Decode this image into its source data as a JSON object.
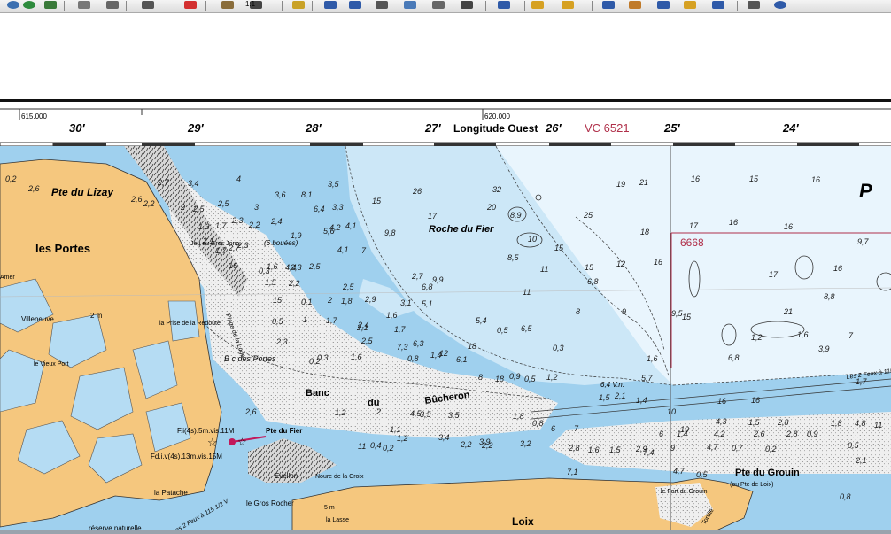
{
  "toolbar": {
    "icons": [
      "globe-icon",
      "refresh-icon",
      "save-icon",
      "page-icon",
      "print-icon",
      "list-icon",
      "close-icon",
      "zoom-icon",
      "zoom-1to1-icon",
      "pan-icon",
      "back-icon",
      "forward-icon",
      "window-icon",
      "layers-icon",
      "edit-icon",
      "dropdown-icon",
      "info-icon",
      "folder-open-icon",
      "folder-icon",
      "binoculars-icon",
      "printer-icon",
      "display-icon",
      "export-icon",
      "import-icon",
      "settings-icon",
      "help-icon"
    ],
    "zoom_label": "1:1"
  },
  "chart_border": {
    "grid_ref_left": "615.000",
    "grid_ref_mid": "620.000",
    "longitudes": [
      "30′",
      "29′",
      "28′",
      "27′",
      "26′",
      "25′",
      "24′"
    ],
    "axis_title": "Longitude Ouest",
    "sheet_ref": "VC 6521",
    "chart_ref": "6668",
    "corner_letter": "P"
  },
  "places": {
    "pte_lizay": "Pte du Lizay",
    "les_portes": "les Portes",
    "amer": "Amer",
    "villeneuve": "Villeneuve",
    "prise_redoute": "la Prise de la Redoute",
    "vieux_port": "le Vieux Port",
    "roche_fier": "Roche du Fier",
    "banc": "Banc",
    "du": "du",
    "bucheron": "Bûcheron",
    "bc_portes": "B c des Portes",
    "plage_loge": "Plage de la Loge",
    "jeu_gros_jonc": "Jeu du Gros Jonc",
    "six_bouees": "(6 bouées)",
    "light1": "F.i(4s).5m.vis.11M",
    "light2": "Fd.i.v(4s).13m.vis.15M",
    "pte_fier": "Pte du Fier",
    "la_patache": "la Patache",
    "evellon": "Evellon",
    "noure_croix": "Noure de la Croix",
    "gros_rocher": "le Gros Rocher",
    "la_lasse": "la Lasse",
    "loix": "Loix",
    "fort_grouin": "le Fort du Grouin",
    "pte_grouin": "Pte du Grouin",
    "pte_loix": "(ou Pte de Loix)",
    "reserve": "réserve naturelle",
    "balisee": "balisée",
    "deux_feux": "Les 2 Feux à 115",
    "deux_feux_2": "Les 2 Feux à 115 1/2 V",
    "la_peux": "le Peux",
    "tonne": "Tonillé",
    "deux_m": "2 m",
    "cinq_m": "5 m",
    "vn": "6,4 V.n."
  },
  "soundings": [
    {
      "t": "0,2"
    },
    {
      "t": "2,6"
    },
    {
      "t": "2,7"
    },
    {
      "t": "3,4"
    },
    {
      "t": "4"
    },
    {
      "t": "3,6"
    },
    {
      "t": "8,1"
    },
    {
      "t": "3,5"
    },
    {
      "t": "3,3"
    },
    {
      "t": "15"
    },
    {
      "t": "26"
    },
    {
      "t": "32"
    },
    {
      "t": "20"
    },
    {
      "t": "8,9"
    },
    {
      "t": "19"
    },
    {
      "t": "21"
    },
    {
      "t": "16"
    },
    {
      "t": "15"
    },
    {
      "t": "16"
    },
    {
      "t": "2,6"
    },
    {
      "t": "2,2"
    },
    {
      "t": "2"
    },
    {
      "t": "2,5"
    },
    {
      "t": "2,5"
    },
    {
      "t": "3"
    },
    {
      "t": "2,4"
    },
    {
      "t": "6,4"
    },
    {
      "t": "4,2"
    },
    {
      "t": "17"
    },
    {
      "t": "25"
    },
    {
      "t": "1,3"
    },
    {
      "t": "1,7"
    },
    {
      "t": "2,3"
    },
    {
      "t": "2,2"
    },
    {
      "t": "1,9"
    },
    {
      "t": "5,6"
    },
    {
      "t": "4,1"
    },
    {
      "t": "9,8"
    },
    {
      "t": "10"
    },
    {
      "t": "18"
    },
    {
      "t": "17"
    },
    {
      "t": "16"
    },
    {
      "t": "16"
    },
    {
      "t": "2,1"
    },
    {
      "t": "1,7"
    },
    {
      "t": "2,7"
    },
    {
      "t": "2,3"
    },
    {
      "t": "4,4"
    },
    {
      "t": "7"
    },
    {
      "t": "8,5"
    },
    {
      "t": "15"
    },
    {
      "t": "12"
    },
    {
      "t": "9,7"
    },
    {
      "t": "17"
    },
    {
      "t": "16"
    },
    {
      "t": "16"
    },
    {
      "t": "0,3"
    },
    {
      "t": "1,6"
    },
    {
      "t": "2,3"
    },
    {
      "t": "2,5"
    },
    {
      "t": "4,1"
    },
    {
      "t": "9,9"
    },
    {
      "t": "11"
    },
    {
      "t": "15"
    },
    {
      "t": "16"
    },
    {
      "t": "1,5"
    },
    {
      "t": "2,2"
    },
    {
      "t": "1,8"
    },
    {
      "t": "2,7"
    },
    {
      "t": "6,8"
    },
    {
      "t": "9,5"
    },
    {
      "t": "15"
    },
    {
      "t": "0,1"
    },
    {
      "t": "2"
    },
    {
      "t": "2,5"
    },
    {
      "t": "2,9"
    },
    {
      "t": "3,1"
    },
    {
      "t": "5,1"
    },
    {
      "t": "6,8"
    },
    {
      "t": "11"
    },
    {
      "t": "9"
    },
    {
      "t": "8,8"
    },
    {
      "t": "0,5"
    },
    {
      "t": "1"
    },
    {
      "t": "1,7"
    },
    {
      "t": "2,1"
    },
    {
      "t": "1,6"
    },
    {
      "t": "5,4"
    },
    {
      "t": "6,5"
    },
    {
      "t": "8"
    },
    {
      "t": "15"
    },
    {
      "t": "21"
    },
    {
      "t": "2,4"
    },
    {
      "t": "2,5"
    },
    {
      "t": "1,7"
    },
    {
      "t": "7,3"
    },
    {
      "t": "6,3"
    },
    {
      "t": "12"
    },
    {
      "t": "18"
    },
    {
      "t": "0,5"
    },
    {
      "t": "0,3"
    },
    {
      "t": "1,6"
    },
    {
      "t": "1,2"
    },
    {
      "t": "1,6"
    },
    {
      "t": "7"
    },
    {
      "t": "6,8"
    },
    {
      "t": "2,3"
    },
    {
      "t": "0,2"
    },
    {
      "t": "0,3"
    },
    {
      "t": "1,6"
    },
    {
      "t": "0,8"
    },
    {
      "t": "1,4"
    },
    {
      "t": "6,1"
    },
    {
      "t": "8"
    },
    {
      "t": "18"
    },
    {
      "t": "0,9"
    },
    {
      "t": "0,5"
    },
    {
      "t": "1,2"
    },
    {
      "t": "1,5"
    },
    {
      "t": "2,1"
    },
    {
      "t": "1,4"
    },
    {
      "t": "5,7"
    },
    {
      "t": "10"
    },
    {
      "t": "16"
    },
    {
      "t": "16"
    },
    {
      "t": "1,7"
    },
    {
      "t": "3,9"
    },
    {
      "t": "2,6"
    },
    {
      "t": "1,2"
    },
    {
      "t": "2"
    },
    {
      "t": "4,5"
    },
    {
      "t": "3,5"
    },
    {
      "t": "3,5"
    },
    {
      "t": "6"
    },
    {
      "t": "7"
    },
    {
      "t": "6"
    },
    {
      "t": "19"
    },
    {
      "t": "4,3"
    },
    {
      "t": "1,5"
    },
    {
      "t": "2,8"
    },
    {
      "t": "1,8"
    },
    {
      "t": "4,8"
    },
    {
      "t": "11"
    },
    {
      "t": "11"
    },
    {
      "t": "0,4"
    },
    {
      "t": "0,2"
    },
    {
      "t": "1,1"
    },
    {
      "t": "1,2"
    },
    {
      "t": "3,4"
    },
    {
      "t": "2,2"
    },
    {
      "t": "2,2"
    },
    {
      "t": "3,2"
    },
    {
      "t": "7,1"
    },
    {
      "t": "7,4"
    },
    {
      "t": "9"
    },
    {
      "t": "4,7"
    },
    {
      "t": "4,7"
    },
    {
      "t": "0,7"
    },
    {
      "t": "0,2"
    },
    {
      "t": "0,5"
    },
    {
      "t": "3,9"
    },
    {
      "t": "0,8"
    },
    {
      "t": "1,8"
    },
    {
      "t": "2,8"
    },
    {
      "t": "1,6"
    },
    {
      "t": "1,5"
    },
    {
      "t": "2,9"
    },
    {
      "t": "1,4"
    },
    {
      "t": "4,2"
    },
    {
      "t": "2,6"
    },
    {
      "t": "2,8"
    },
    {
      "t": "0,9"
    },
    {
      "t": "2,1"
    },
    {
      "t": "0,5"
    },
    {
      "t": "0,8"
    }
  ],
  "colors": {
    "land": "#f5c77e",
    "shallow": "#9fd0ee",
    "medium": "#cce7f7",
    "deep": "#e9f5fd",
    "foreshore": "#e6e6e6",
    "marsh_water": "#b5dcf3",
    "sheet_ref": "#b0304a"
  }
}
